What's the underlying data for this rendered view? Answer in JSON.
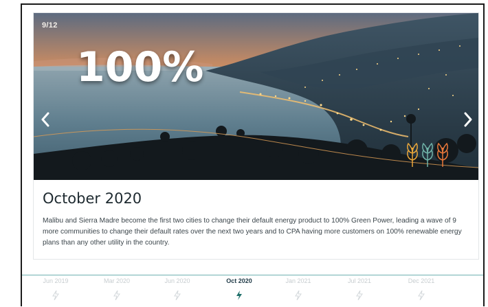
{
  "slide": {
    "counter": "9/12",
    "big_stat": "100%",
    "title": "October 2020",
    "description": "Malibu and Sierra Madre become the first two cities to change their default energy product to 100% Green Power, leading a wave of 9 more communities to change their default rates over the next two years and to CPA having more customers on 100% renewable energy plans than any other utility in the country."
  },
  "navigation": {
    "prev_icon": "chevron-left-icon",
    "next_icon": "chevron-right-icon"
  },
  "timeline": {
    "items": [
      {
        "label": "Jun 2019",
        "icon": "bolt-icon",
        "active": false
      },
      {
        "label": "Mar 2020",
        "icon": "bolt-icon",
        "active": false
      },
      {
        "label": "Jun 2020",
        "icon": "bolt-icon",
        "active": false
      },
      {
        "label": "Oct 2020",
        "icon": "bolt-icon",
        "active": true
      },
      {
        "label": "Jan 2021",
        "icon": "bolt-icon",
        "active": false
      },
      {
        "label": "Jul 2021",
        "icon": "bolt-icon",
        "active": false
      },
      {
        "label": "Dec 2021",
        "icon": "bolt-icon",
        "active": false
      }
    ]
  },
  "colors": {
    "accent": "#1f6f6a",
    "active_label": "#1f3a47",
    "inactive": "#c7cdd0",
    "timeline_line": "#6fb0b0"
  }
}
